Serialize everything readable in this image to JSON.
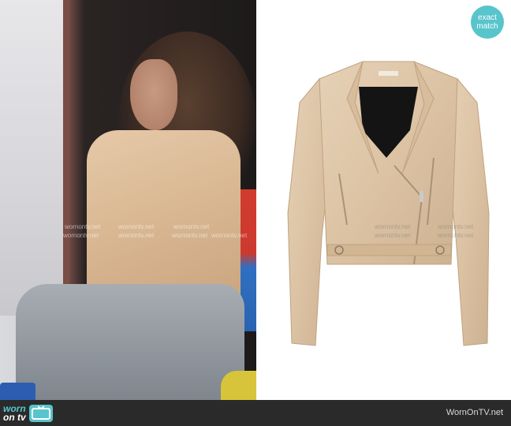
{
  "badge": {
    "line1": "exact",
    "line2": "match"
  },
  "watermark": "wornontv.net",
  "footer": {
    "logo_line1": "worn",
    "logo_line2": "on tv",
    "site": "WornOnTV.net"
  },
  "icons": {
    "badge": "exact-match-badge",
    "logo": "tv-icon"
  },
  "colors": {
    "accent": "#58c4cc",
    "footer_bg": "#2a2a2a",
    "jacket": "#dcc3a4"
  }
}
